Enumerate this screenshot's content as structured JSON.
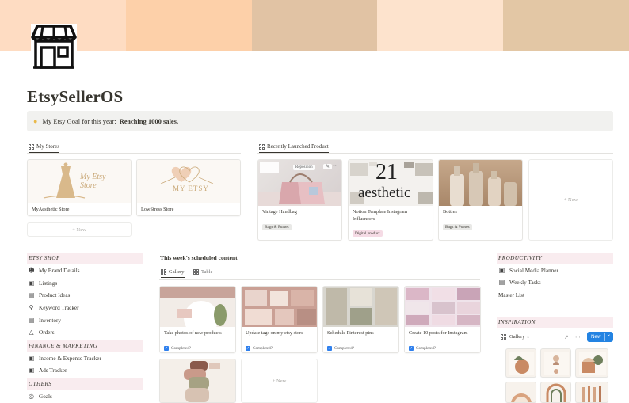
{
  "banner": {
    "colors": [
      "#fedcc2",
      "#fdd0a9",
      "#e1c3a4",
      "#fde3cd",
      "#e3c7a5"
    ]
  },
  "page": {
    "title": "EtsySellerOS",
    "icon": "storefront-icon"
  },
  "callout": {
    "icon": "lightbulb-icon",
    "text": "My Etsy Goal for this year:",
    "bold": "Reaching 1000 sales."
  },
  "stores": {
    "tab_label": "My Stores",
    "items": [
      {
        "name": "MyAesthetic Store",
        "logo_text": "My Etsy Store"
      },
      {
        "name": "LowStress Store",
        "logo_text": "MY ETSY"
      }
    ],
    "new_label": "+ New"
  },
  "launched": {
    "tab_label": "Recently Launched Product",
    "items": [
      {
        "name": "Vintage Handbag",
        "tag": "Bags & Purses",
        "overlay": "Reposition"
      },
      {
        "name": "Notion Template Instagram Influencers",
        "tag": "Digital product",
        "img_text_big": "21",
        "img_text": "aesthetic"
      },
      {
        "name": "Bottles",
        "tag": "Bags & Purses"
      }
    ],
    "new_label": "+ New"
  },
  "sidebar_left": {
    "sections": [
      {
        "title": "ETSY SHOP",
        "items": [
          {
            "label": "My Brand Details",
            "icon": "people-icon"
          },
          {
            "label": "Listings",
            "icon": "cart-icon"
          },
          {
            "label": "Product Ideas",
            "icon": "document-icon"
          },
          {
            "label": "Keyword Tracker",
            "icon": "search-icon"
          },
          {
            "label": "Inventory",
            "icon": "document-icon"
          },
          {
            "label": "Orders",
            "icon": "bag-icon"
          }
        ]
      },
      {
        "title": "FINANCE & MARKETING",
        "items": [
          {
            "label": "Income & Expense Tracker",
            "icon": "folder-icon"
          },
          {
            "label": "Ads Tracker",
            "icon": "folder-icon"
          }
        ]
      },
      {
        "title": "OTHERS",
        "items": [
          {
            "label": "Goals",
            "icon": "target-icon"
          }
        ]
      }
    ]
  },
  "schedule": {
    "title": "This week's scheduled content",
    "tabs": [
      "Gallery",
      "Table"
    ],
    "completed_label": "Completed?",
    "cards": [
      {
        "title": "Take photos of new products"
      },
      {
        "title": "Update tags on my etsy store"
      },
      {
        "title": "Schedule Pinterest pins"
      },
      {
        "title": "Create 10 posts for Instagram"
      }
    ],
    "new_label": "+ New"
  },
  "sidebar_right": {
    "productivity_title": "PRODUCTIVITY",
    "productivity_items": [
      {
        "label": "Social Media Planner",
        "icon": "folder-icon"
      },
      {
        "label": "Weekly Tasks",
        "icon": "calendar-icon"
      }
    ],
    "master_list": "Master List",
    "inspiration_title": "INSPIRATION",
    "view_label": "Gallery",
    "new_button": "New"
  }
}
